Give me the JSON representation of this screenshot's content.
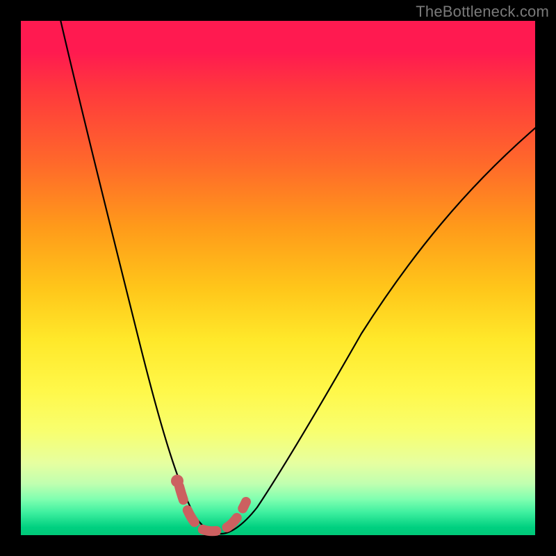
{
  "watermark": "TheBottleneck.com",
  "colors": {
    "marker": "#cc6060",
    "curve": "#000000",
    "gradient_top": "#ff1a50",
    "gradient_bottom": "#00c878"
  },
  "chart_data": {
    "type": "line",
    "title": "",
    "xlabel": "",
    "ylabel": "",
    "xlim": [
      0,
      100
    ],
    "ylim": [
      0,
      100
    ],
    "grid": false,
    "legend": false,
    "annotations": [
      "TheBottleneck.com"
    ],
    "series": [
      {
        "name": "bottleneck-curve",
        "x": [
          5,
          8,
          11,
          14,
          17,
          20,
          23,
          26,
          28,
          30,
          32,
          34,
          36,
          38,
          42,
          46,
          50,
          55,
          60,
          66,
          72,
          78,
          84,
          90,
          96,
          100
        ],
        "y": [
          100,
          90,
          79,
          68,
          57,
          46,
          36,
          26,
          18,
          11,
          6,
          2,
          0,
          0,
          2,
          7,
          14,
          23,
          32,
          42,
          51,
          59,
          66,
          72,
          77,
          80
        ]
      }
    ],
    "highlight": {
      "name": "optimal-range",
      "x": [
        30,
        32,
        34,
        36,
        38,
        40
      ],
      "y": [
        11,
        5,
        1,
        0,
        0.5,
        4
      ]
    }
  }
}
